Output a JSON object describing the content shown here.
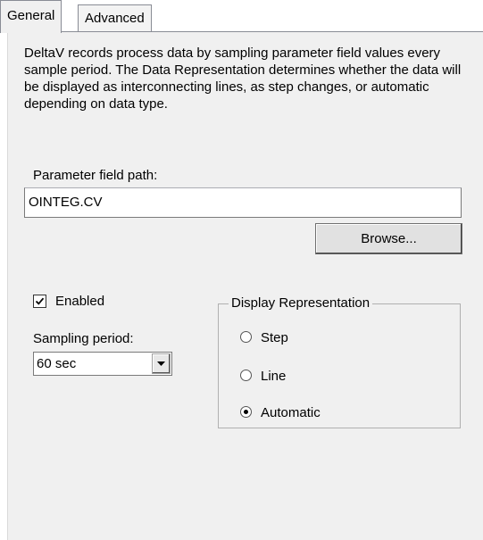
{
  "tabs": [
    {
      "label": "General",
      "active": true
    },
    {
      "label": "Advanced",
      "active": false
    }
  ],
  "description": "DeltaV records process data by sampling parameter field values every sample period. The Data Representation determines whether the data will be displayed as interconnecting lines, as step changes, or automatic depending on data type.",
  "parameter_path": {
    "label": "Parameter field path:",
    "value": "OINTEG.CV"
  },
  "browse_label": "Browse...",
  "enabled": {
    "label": "Enabled",
    "checked": true
  },
  "sampling": {
    "label": "Sampling period:",
    "value": "60 sec"
  },
  "display_representation": {
    "title": "Display Representation",
    "options": [
      {
        "label": "Step",
        "selected": false
      },
      {
        "label": "Line",
        "selected": false
      },
      {
        "label": "Automatic",
        "selected": true
      }
    ]
  },
  "colors": {
    "panel_bg": "#f0f0f0",
    "border": "#898c95"
  }
}
